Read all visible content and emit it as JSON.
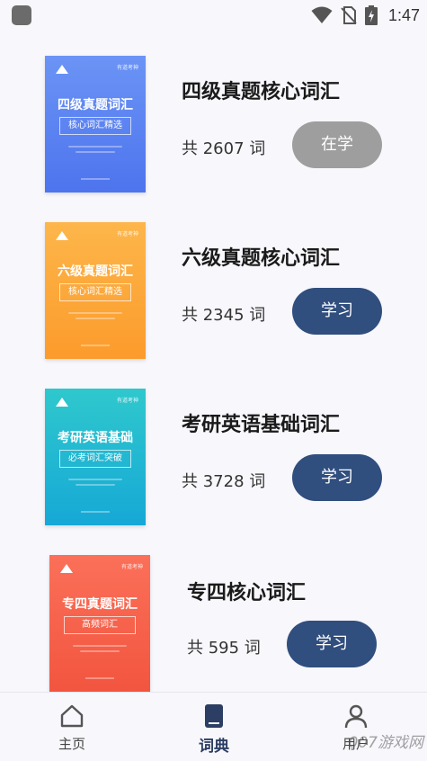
{
  "status_bar": {
    "time": "1:47"
  },
  "books": [
    {
      "title": "四级真题核心词汇",
      "count": "共 2607 词",
      "button": "在学",
      "cover": {
        "brand": "有道考神",
        "title": "四级真题词汇",
        "subtitle": "核心词汇精选"
      }
    },
    {
      "title": "六级真题核心词汇",
      "count": "共 2345 词",
      "button": "学习",
      "cover": {
        "brand": "有道考神",
        "title": "六级真题词汇",
        "subtitle": "核心词汇精选"
      }
    },
    {
      "title": "考研英语基础词汇",
      "count": "共 3728 词",
      "button": "学习",
      "cover": {
        "brand": "有道考神",
        "title": "考研英语基础",
        "subtitle": "必考词汇突破"
      }
    },
    {
      "title": "专四核心词汇",
      "count": "共 595 词",
      "button": "学习",
      "cover": {
        "brand": "有道考神",
        "title": "专四真题词汇",
        "subtitle": "高频词汇"
      }
    }
  ],
  "bottom_nav": {
    "home": "主页",
    "dictionary": "词典",
    "user": "用户"
  },
  "watermark": "007游戏网",
  "colors": {
    "active_button": "#9e9e9e",
    "study_button": "#304e7e"
  }
}
